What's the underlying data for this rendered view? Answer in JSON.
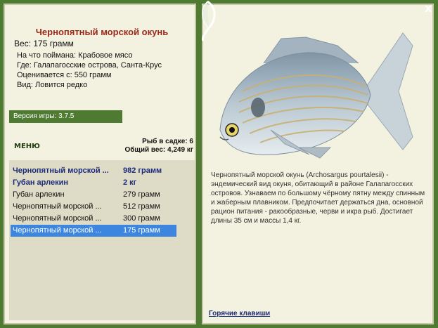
{
  "fish": {
    "title": "Чернопятный морской окунь",
    "weight_line": "Вес: 175 грамм",
    "bait_line": "На что поймана: Крабовое мясо",
    "location_line": "Где: Галапагосские острова, Санта-Крус",
    "value_line": "Оценивается с: 550 грамм",
    "kind_line": "Вид: Ловится редко",
    "description": "Чернопятный морской окунь (Archosargus pourtalesii) - эндемический вид окуня, обитающий в районе Галапагосских островов. Узнаваем по большому чёрному пятну между спинным и жаберным плавником. Предпочитает держаться дна, основной рацион питания - ракообразные, черви и икра рыб. Достигает длины 35 см и массы 1,4 кг."
  },
  "version": "Версия игры: 3.7.5",
  "menu_label": "МЕНЮ",
  "stats": {
    "in_cage": "Рыб в садке: 6",
    "total_weight": "Общий вес: 4,249 кг"
  },
  "catch_list": [
    {
      "name": "Чернопятный морской ...",
      "weight": "982 грамм",
      "bold": true,
      "selected": false
    },
    {
      "name": "Губан арлекин",
      "weight": "2 кг",
      "bold": true,
      "selected": false
    },
    {
      "name": "Губан арлекин",
      "weight": "279 грамм",
      "bold": false,
      "selected": false
    },
    {
      "name": "Чернопятный морской ...",
      "weight": "512 грамм",
      "bold": false,
      "selected": false
    },
    {
      "name": "Чернопятный морской ...",
      "weight": "300 грамм",
      "bold": false,
      "selected": false
    },
    {
      "name": "Чернопятный морской ...",
      "weight": "175 грамм",
      "bold": false,
      "selected": true
    }
  ],
  "hotkeys_label": "Горячие клавиши",
  "close_symbol": "x",
  "colors": {
    "frame_green": "#4f7a32",
    "panel_bg": "#f3f1df",
    "title_red": "#9b2a1a",
    "selection_blue": "#3d86e0"
  }
}
